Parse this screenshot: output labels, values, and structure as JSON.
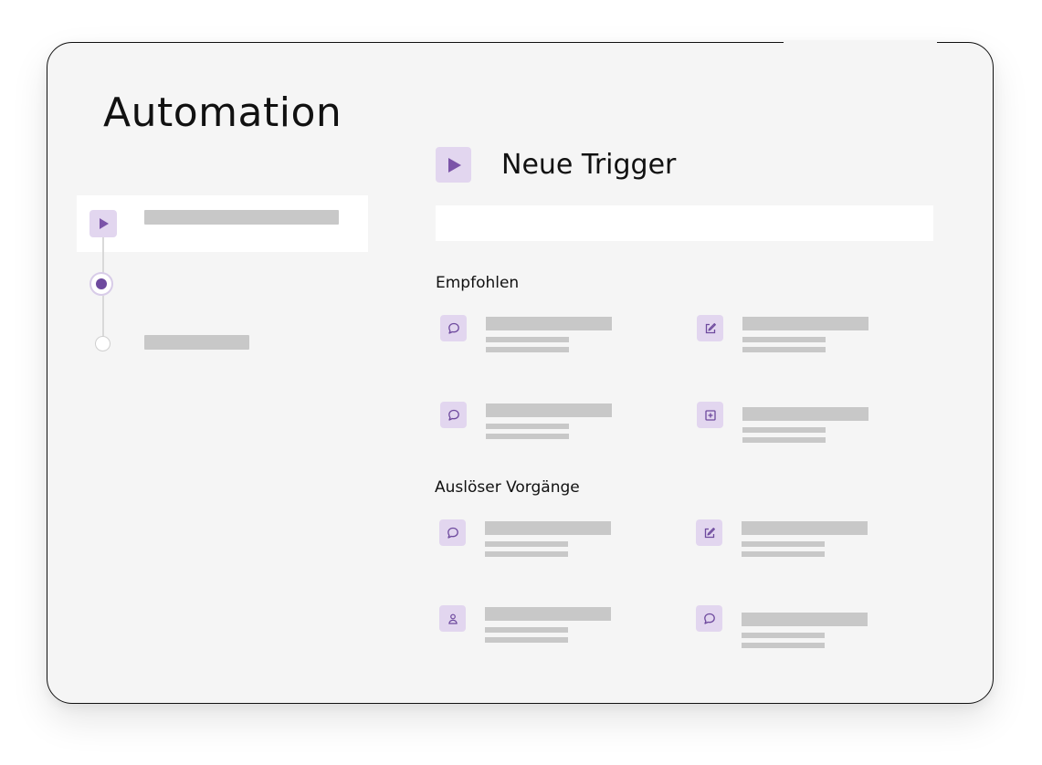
{
  "app": {
    "title": "Automation"
  },
  "panel": {
    "title": "Neue Trigger",
    "search": {
      "value": "",
      "placeholder": ""
    }
  },
  "stepper": {
    "steps": [
      {
        "state": "trigger",
        "icon": "play-icon"
      },
      {
        "state": "active",
        "icon": "step-dot-active-icon"
      },
      {
        "state": "pending",
        "icon": "step-dot-empty-icon"
      }
    ]
  },
  "sections": {
    "recommended": {
      "label": "Empfohlen",
      "items": [
        {
          "icon": "chat-bubble-icon"
        },
        {
          "icon": "edit-icon"
        },
        {
          "icon": "chat-bubble-icon"
        },
        {
          "icon": "add-box-icon"
        }
      ]
    },
    "trigger_events": {
      "label": "Auslöser Vorgänge",
      "items": [
        {
          "icon": "chat-bubble-icon"
        },
        {
          "icon": "edit-icon"
        },
        {
          "icon": "user-icon"
        },
        {
          "icon": "chat-bubble-icon"
        }
      ]
    }
  },
  "colors": {
    "accent": "#7b54a8",
    "accent_soft": "#e2d6ef",
    "placeholder_bar": "#c8c8c8",
    "panel_bg": "#f5f5f5"
  }
}
